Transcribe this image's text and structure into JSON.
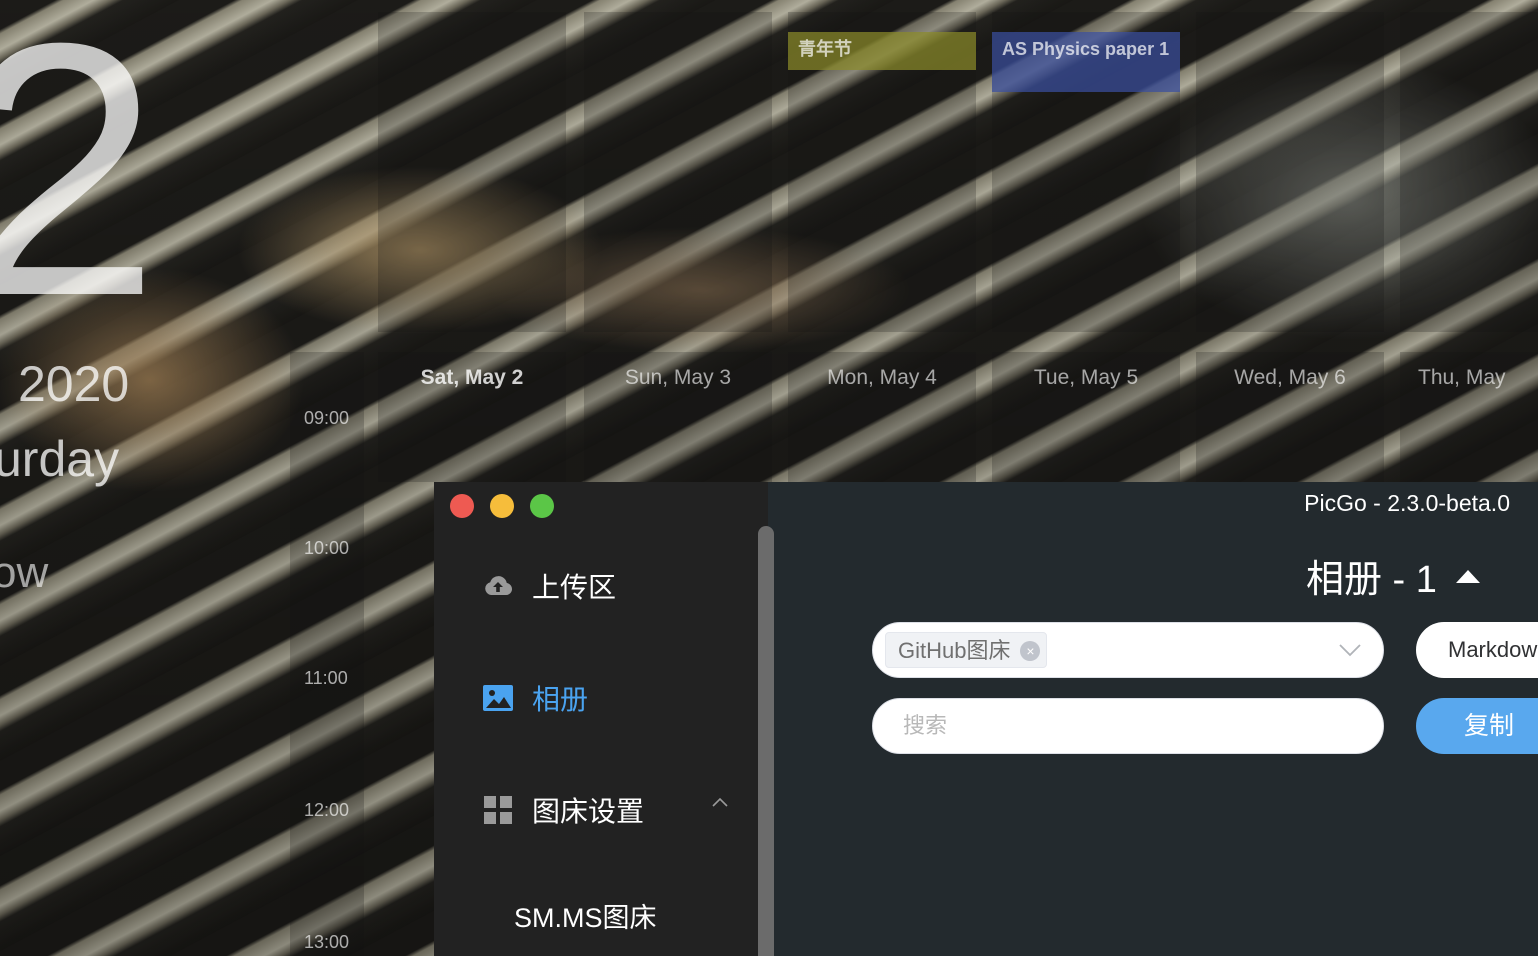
{
  "desktop": {
    "big_digit": "2",
    "year": "2020",
    "weekday_fragment": "urday",
    "tomorrow_fragment": "ow",
    "days": [
      {
        "label": "Sat, May 2",
        "today": true
      },
      {
        "label": "Sun, May 3",
        "today": false
      },
      {
        "label": "Mon, May 4",
        "today": false
      },
      {
        "label": "Tue, May 5",
        "today": false
      },
      {
        "label": "Wed, May 6",
        "today": false
      },
      {
        "label": "Thu, May",
        "today": false
      }
    ],
    "times": [
      "09:00",
      "10:00",
      "11:00",
      "12:00",
      "13:00"
    ],
    "events": [
      {
        "title": "青年节",
        "color": "#8a8a2a"
      },
      {
        "title": "AS Physics paper 1",
        "color": "#3a4fa0"
      }
    ]
  },
  "window": {
    "title": "PicGo - 2.3.0-beta.0",
    "sidebar": {
      "items": [
        {
          "label": "上传区",
          "icon": "cloud-upload-icon",
          "active": false
        },
        {
          "label": "相册",
          "icon": "image-icon",
          "active": true
        },
        {
          "label": "图床设置",
          "icon": "grid-icon",
          "active": false
        }
      ],
      "submenu": [
        "SM.MS图床"
      ]
    },
    "gallery": {
      "title": "相册 - 1",
      "picbed_tag": "GitHub图床",
      "format_value": "Markdown",
      "search_placeholder": "搜索",
      "copy_label": "复制"
    }
  },
  "colors": {
    "sidebar_bg": "#222222",
    "main_bg": "#232a2e",
    "accent": "#4aa3f0",
    "copy_button": "#59a8ee"
  }
}
